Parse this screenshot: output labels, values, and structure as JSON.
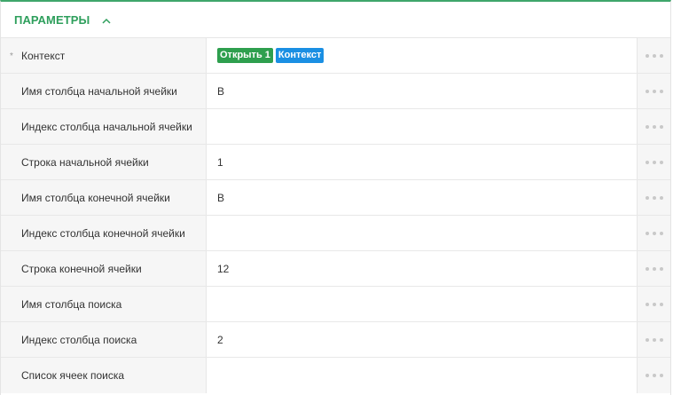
{
  "header": {
    "title": "ПАРАМЕТРЫ",
    "collapse_icon": "chevron-up-icon"
  },
  "colors": {
    "accent": "#2e9f5c",
    "chip_green": "#2e9f4e",
    "chip_blue": "#1a8fe3"
  },
  "rows": [
    {
      "label": "Контекст",
      "required": true,
      "required_mark": "*",
      "chips": [
        "Открыть 1",
        "Контекст"
      ],
      "value": ""
    },
    {
      "label": "Имя столбца начальной ячейки",
      "value": "B"
    },
    {
      "label": "Индекс столбца начальной ячейки",
      "value": ""
    },
    {
      "label": "Строка начальной ячейки",
      "value": "1"
    },
    {
      "label": "Имя столбца конечной ячейки",
      "value": "B"
    },
    {
      "label": "Индекс столбца конечной ячейки",
      "value": ""
    },
    {
      "label": "Строка конечной ячейки",
      "value": "12"
    },
    {
      "label": "Имя столбца поиска",
      "value": ""
    },
    {
      "label": "Индекс столбца поиска",
      "value": "2"
    },
    {
      "label": "Список ячеек поиска",
      "value": ""
    }
  ]
}
